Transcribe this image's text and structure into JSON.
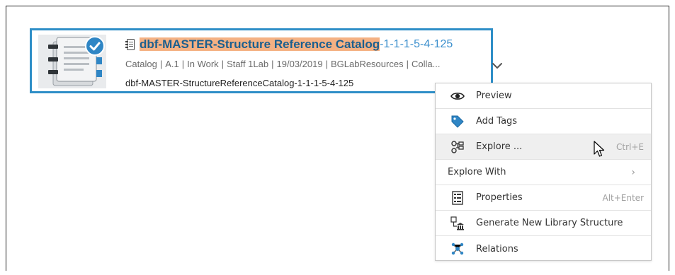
{
  "card": {
    "title_highlight": "dbf-MASTER-Structure Reference Catalog",
    "title_suffix": "-1-1-1-5-4-125",
    "meta": {
      "type": "Catalog",
      "revision": "A.1",
      "state": "In Work",
      "owner": "Staff 1Lab",
      "date": "19/03/2019",
      "organization": "BGLabResources",
      "collab": "Colla..."
    },
    "meta_separator": "|",
    "name": "dbf-MASTER-StructureReferenceCatalog-1-1-1-5-4-125",
    "thumbnail_icon": "catalog-book-icon",
    "status_icon": "checkmark-badge-icon",
    "expand_icon": "chevron-down-icon"
  },
  "context_menu": {
    "items": [
      {
        "label": "Preview",
        "icon": "eye-icon",
        "shortcut": ""
      },
      {
        "label": "Add Tags",
        "icon": "tag-icon",
        "shortcut": ""
      },
      {
        "label": "Explore ...",
        "icon": "explore-tree-icon",
        "shortcut": "Ctrl+E"
      },
      {
        "label": "Explore With",
        "icon": "",
        "shortcut": "",
        "submenu": true
      },
      {
        "label": "Properties",
        "icon": "properties-icon",
        "shortcut": "Alt+Enter"
      },
      {
        "label": "Generate New Library Structure",
        "icon": "library-structure-icon",
        "shortcut": ""
      },
      {
        "label": "Relations",
        "icon": "relations-icon",
        "shortcut": ""
      }
    ],
    "submenu_arrow": "›"
  },
  "colors": {
    "card_border": "#2e8ec7",
    "highlight": "#f4b183",
    "title": "#1b5f8f",
    "title_suffix": "#3b8fcd"
  }
}
